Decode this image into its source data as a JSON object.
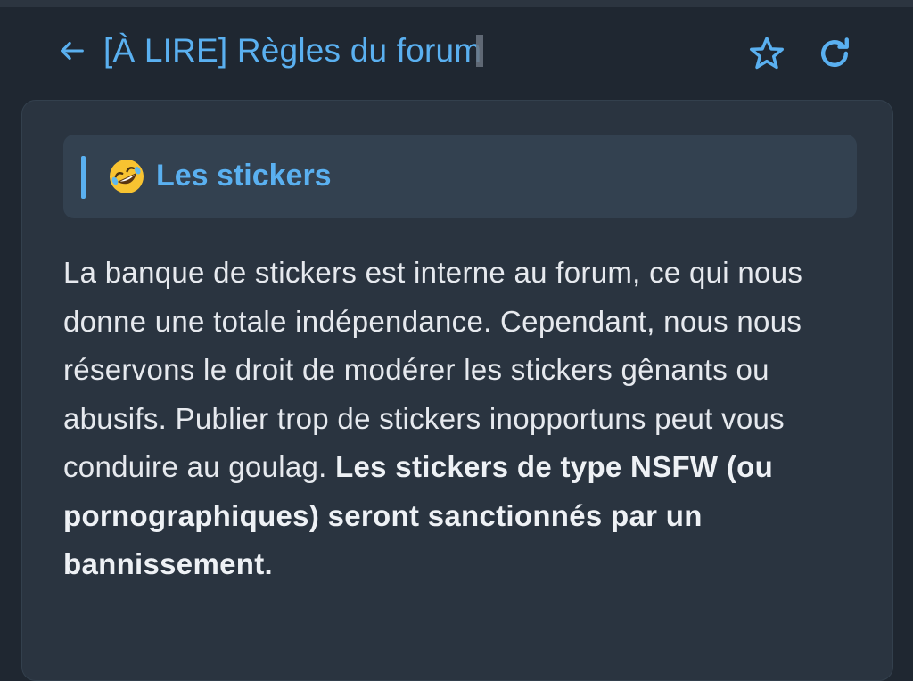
{
  "header": {
    "title": "[À LIRE] Règles du forum",
    "back_icon": "arrow-left-icon",
    "star_icon": "star-icon",
    "refresh_icon": "refresh-icon"
  },
  "section": {
    "emoji": "rofl-emoji",
    "title": "Les stickers"
  },
  "body": {
    "text_regular": "La banque de stickers est interne au forum, ce qui nous donne une totale indépendance. Cependant, nous nous réservons le droit de modérer les stickers gênants ou abusifs. Publier trop de stickers inopportuns peut vous conduire au goulag. ",
    "text_bold": "Les stickers de type NSFW (ou pornographiques) seront sanctionnés par un bannissement."
  },
  "colors": {
    "accent": "#5ab0f0",
    "background": "#1f2731",
    "card": "#2a3440",
    "section_header": "#334150",
    "text": "#e6e9ee"
  }
}
